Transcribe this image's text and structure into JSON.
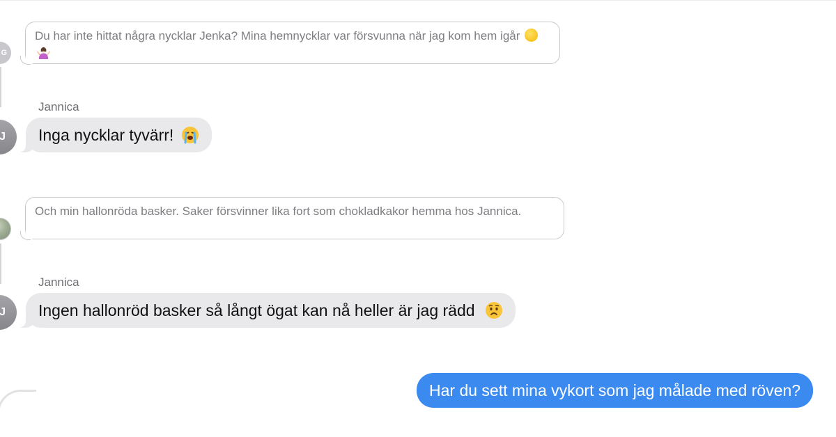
{
  "conversation": {
    "messages": [
      {
        "kind": "quote",
        "avatar_initial": "G",
        "text": "Du har inte hittat några nycklar Jenka? Mina hemnycklar var försvunna när jag kom hem igår",
        "emojis": [
          "sweat-smile-emoji",
          "woman-shrugging-emoji"
        ]
      },
      {
        "kind": "incoming",
        "sender": "Jannica",
        "avatar_initial": "J",
        "text": "Inga nycklar tyvärr!",
        "emoji": "loudly-crying-face-emoji"
      },
      {
        "kind": "quote",
        "avatar_initial": "",
        "text": "Och min hallonröda basker. Saker försvinner lika fort som chokladkakor hemma hos Jannica."
      },
      {
        "kind": "incoming",
        "sender": "Jannica",
        "avatar_initial": "J",
        "text": "Ingen hallonröd basker så långt ögat kan nå heller är jag rädd",
        "emoji": "worried-face-emoji"
      },
      {
        "kind": "outgoing",
        "text": "Har du sett mina vykort som jag målade med röven?"
      }
    ]
  },
  "colors": {
    "outgoing_bubble": "#3b8aef",
    "incoming_bubble": "#e9e9eb",
    "quote_border": "#c9c9cc",
    "quote_text": "#7d7d82",
    "sender_name": "#6e6e73"
  }
}
